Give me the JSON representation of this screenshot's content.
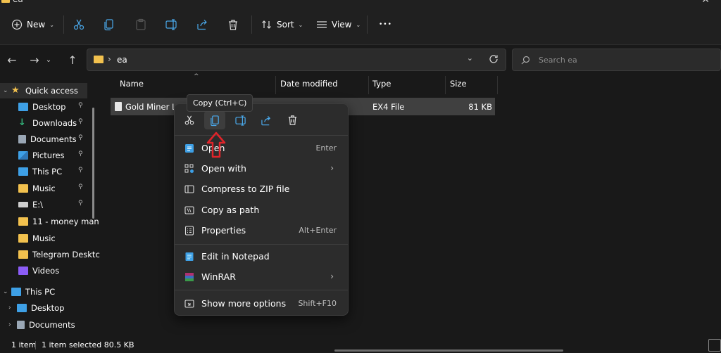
{
  "window": {
    "title": "ea",
    "close_glyph": "✕"
  },
  "toolbar": {
    "new_label": "New",
    "sort_label": "Sort",
    "view_label": "View",
    "more_label": "•••",
    "dropdown_glyph": "⌄"
  },
  "nav": {
    "back": "←",
    "forward": "→",
    "dropdown": "⌄",
    "up": "↑"
  },
  "address": {
    "path": "ea",
    "separator": "›",
    "dropdown_glyph": "⌄"
  },
  "search": {
    "placeholder": "Search ea"
  },
  "sidebar": {
    "items": [
      {
        "label": "Quick access",
        "icon": "star-icon",
        "color": "#f2c14e",
        "expand": "⌄",
        "pinned": false
      },
      {
        "label": "Desktop",
        "icon": "desktop-icon",
        "color": "#3ea0e6",
        "pinned": true
      },
      {
        "label": "Downloads",
        "icon": "download-icon",
        "color": "#33b37a",
        "pinned": true
      },
      {
        "label": "Documents",
        "icon": "documents-icon",
        "color": "#9aa7b5",
        "pinned": true
      },
      {
        "label": "Pictures",
        "icon": "pictures-icon",
        "color": "#3ea0e6",
        "pinned": true
      },
      {
        "label": "This PC",
        "icon": "pc-icon",
        "color": "#3ea0e6",
        "pinned": true
      },
      {
        "label": "Music",
        "icon": "folder-icon",
        "color": "#f2c14e",
        "pinned": true
      },
      {
        "label": "E:\\",
        "icon": "drive-icon",
        "color": "#cfcfcf",
        "pinned": true
      },
      {
        "label": "11 - money man",
        "icon": "folder-icon",
        "color": "#f2c14e",
        "pinned": false
      },
      {
        "label": "Music",
        "icon": "folder-icon",
        "color": "#f2c14e",
        "pinned": false
      },
      {
        "label": "Telegram Desktc",
        "icon": "folder-icon",
        "color": "#f2c14e",
        "pinned": false
      },
      {
        "label": "Videos",
        "icon": "videos-icon",
        "color": "#8b5cf6",
        "pinned": false
      },
      {
        "label": "This PC",
        "icon": "pc-icon",
        "color": "#3ea0e6",
        "expand": "⌄",
        "pinned": false
      },
      {
        "label": "Desktop",
        "icon": "desktop-icon",
        "color": "#3ea0e6",
        "expand": "›",
        "pinned": false
      },
      {
        "label": "Documents",
        "icon": "documents-icon",
        "color": "#9aa7b5",
        "expand": "›",
        "pinned": false
      }
    ],
    "pin_glyph": "📌"
  },
  "columns": {
    "name": "Name",
    "date": "Date modified",
    "type": "Type",
    "size": "Size",
    "sort_glyph": "^"
  },
  "file": {
    "name": "Gold Miner La",
    "type": "EX4 File",
    "size": "81 KB"
  },
  "tooltip": "Copy (Ctrl+C)",
  "context_menu": {
    "quick_actions": [
      "cut-icon",
      "copy-icon",
      "rename-icon",
      "share-icon",
      "delete-icon"
    ],
    "items": [
      {
        "label": "Open",
        "shortcut": "Enter",
        "icon": "open-icon"
      },
      {
        "label": "Open with",
        "submenu": "›",
        "icon": "open-with-icon"
      },
      {
        "label": "Compress to ZIP file",
        "icon": "zip-icon"
      },
      {
        "label": "Copy as path",
        "icon": "copy-path-icon"
      },
      {
        "label": "Properties",
        "shortcut": "Alt+Enter",
        "icon": "properties-icon"
      },
      {
        "label": "Edit in Notepad",
        "icon": "notepad-icon"
      },
      {
        "label": "WinRAR",
        "submenu": "›",
        "icon": "winrar-icon"
      },
      {
        "label": "Show more options",
        "shortcut": "Shift+F10",
        "icon": "more-options-icon"
      }
    ]
  },
  "status": {
    "count": "1 item",
    "selected": "1 item selected  80.5 KB"
  },
  "colors": {
    "accent": "#3ea0e6",
    "highlight_arrow": "#e0242a",
    "selection": "#404040",
    "menu_bg": "#2c2c2c"
  }
}
